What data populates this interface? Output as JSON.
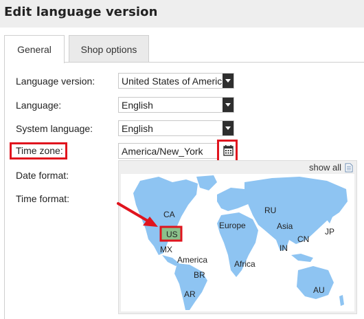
{
  "title": "Edit language version",
  "tabs": [
    {
      "label": "General",
      "active": true
    },
    {
      "label": "Shop options",
      "active": false
    }
  ],
  "form": {
    "language_version_label": "Language version:",
    "language_version_value": "United States of America",
    "language_label": "Language:",
    "language_value": "English",
    "system_language_label": "System language:",
    "system_language_value": "English",
    "time_zone_label": "Time zone:",
    "time_zone_value": "America/New_York",
    "date_format_label": "Date format:",
    "time_format_label": "Time format:"
  },
  "map": {
    "show_all": "show all",
    "regions": {
      "ca": "CA",
      "us": "US",
      "mx": "MX",
      "america": "America",
      "br": "BR",
      "ar": "AR",
      "europe": "Europe",
      "africa": "Africa",
      "ru": "RU",
      "asia": "Asia",
      "cn": "CN",
      "jp": "JP",
      "in": "IN",
      "au": "AU"
    }
  },
  "colors": {
    "highlight": "#e0141e",
    "map_land": "#8ec4f2",
    "map_selected": "#8bc18b"
  },
  "icons": [
    "calendar-icon",
    "document-icon",
    "red-arrow"
  ]
}
